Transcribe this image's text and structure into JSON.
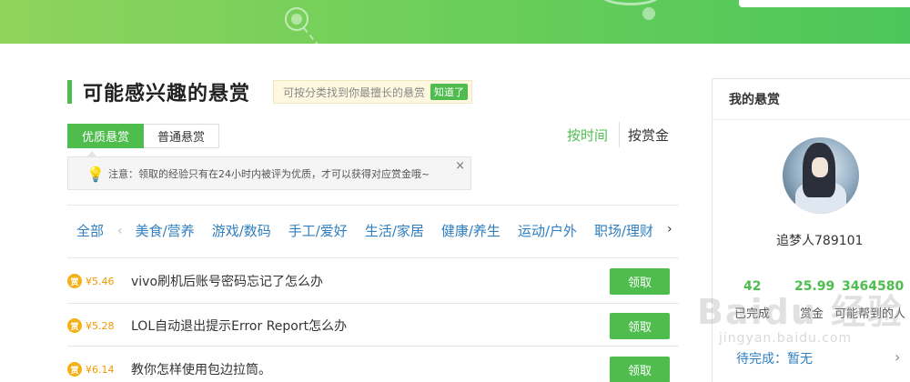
{
  "banner": {
    "accent": "#4ebd4e"
  },
  "header": {
    "title": "可能感兴趣的悬赏",
    "hint_text": "可按分类找到你最擅长的悬赏",
    "hint_button": "知道了"
  },
  "tabs": [
    {
      "label": "优质悬赏",
      "active": true
    },
    {
      "label": "普通悬赏",
      "active": false
    }
  ],
  "sort": {
    "by_time": "按时间",
    "by_reward": "按赏金"
  },
  "notice": {
    "icon": "bulb-icon",
    "text": "注意：领取的经验只有在24小时内被评为优质，才可以获得对应赏金哦~",
    "close": "×"
  },
  "categories": {
    "all": "全部",
    "items": [
      "美食/营养",
      "游戏/数码",
      "手工/爱好",
      "生活/家居",
      "健康/养生",
      "运动/户外",
      "职场/理财"
    ],
    "prev": "‹",
    "next": "›"
  },
  "questions": [
    {
      "coin": "赏",
      "price": "¥5.46",
      "text": "vivo刷机后账号密码忘记了怎么办",
      "action": "领取"
    },
    {
      "coin": "赏",
      "price": "¥5.28",
      "text": "LOL自动退出提示Error Report怎么办",
      "action": "领取"
    },
    {
      "coin": "赏",
      "price": "¥6.14",
      "text": "教你怎样使用包边拉筒。",
      "action": "领取"
    }
  ],
  "sidebar": {
    "title": "我的悬赏",
    "username": "追梦人789101",
    "stats": [
      {
        "value": "42",
        "label": "已完成"
      },
      {
        "value": "25.99",
        "label": "赏金"
      },
      {
        "value": "3464580",
        "label": "可能帮到的人"
      }
    ],
    "pending": "待完成：暂无",
    "arrow": "›"
  },
  "watermark": {
    "big": "Baidu 经验",
    "small": "jingyan.baidu.com"
  }
}
